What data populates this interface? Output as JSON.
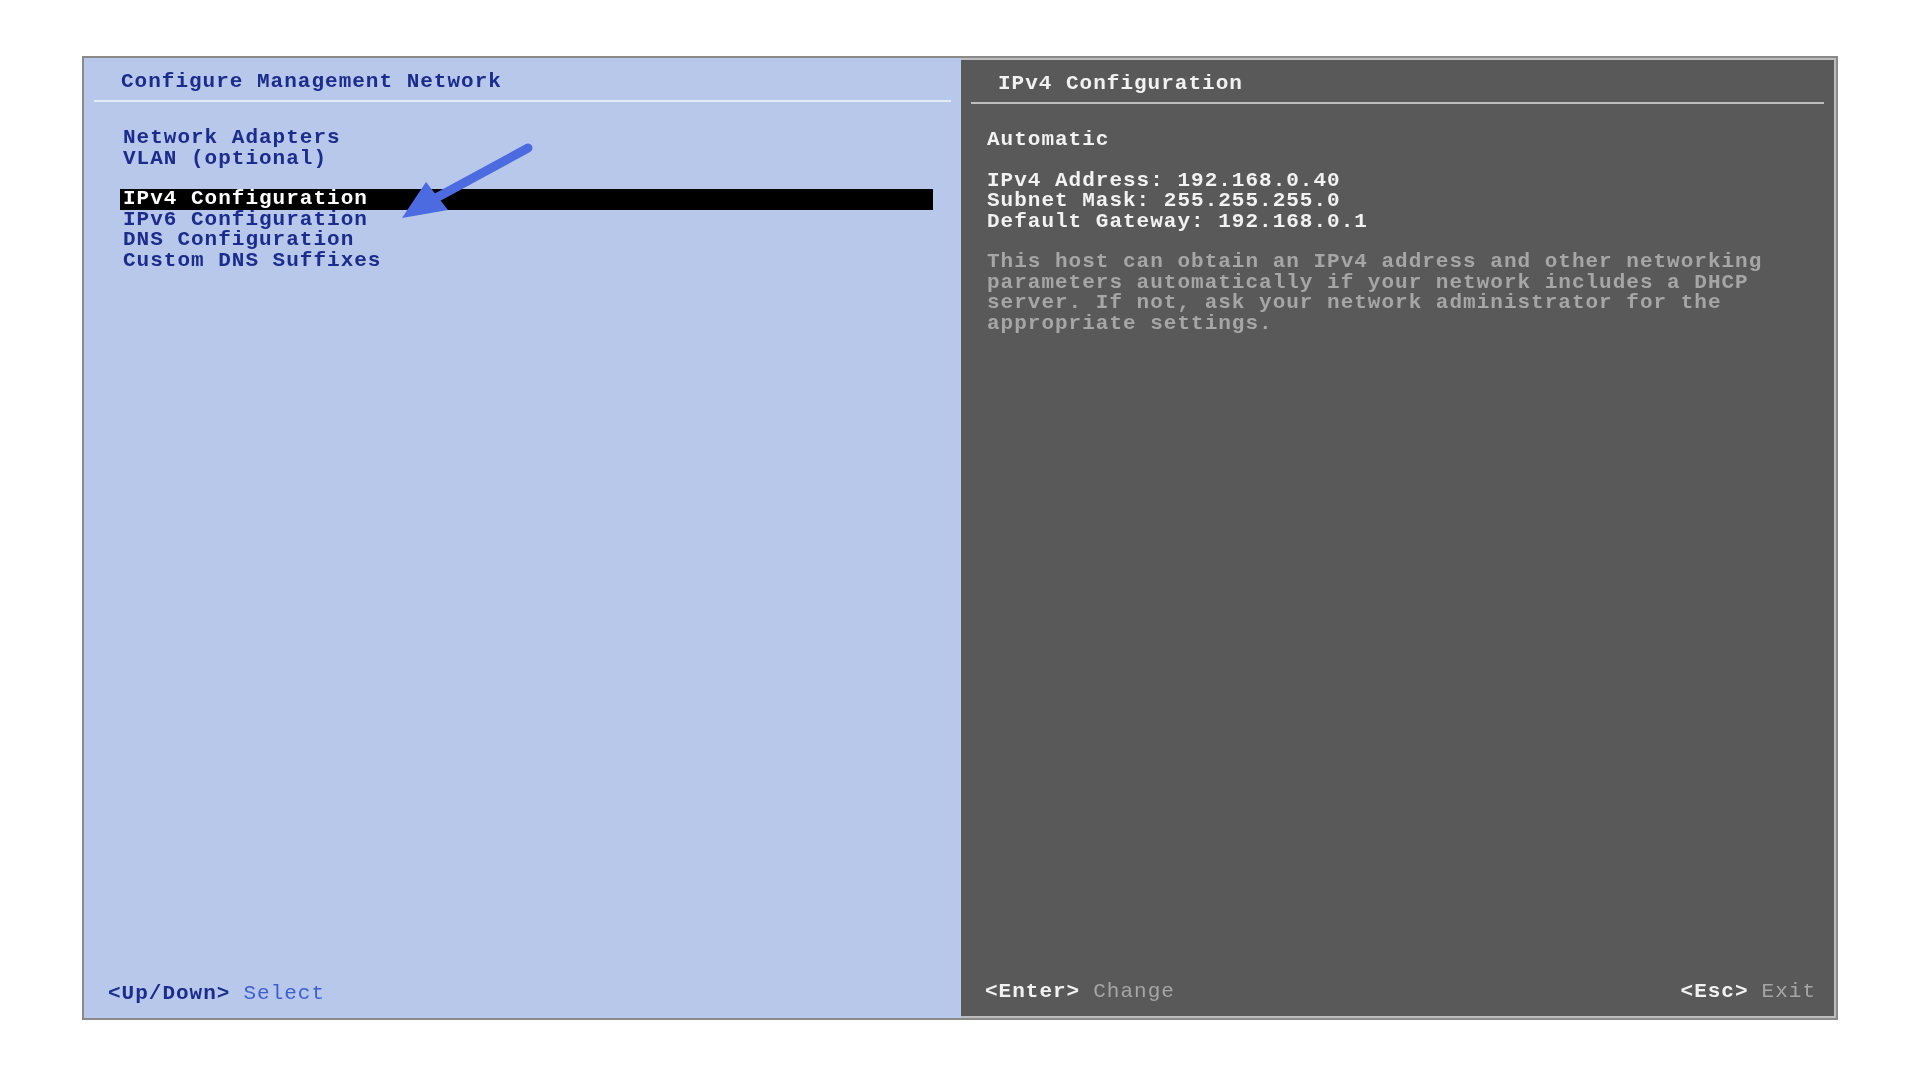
{
  "left_panel": {
    "title": "Configure Management Network",
    "menu_groups": [
      [
        {
          "label": "Network Adapters",
          "selected": false
        },
        {
          "label": "VLAN (optional)",
          "selected": false
        }
      ],
      [
        {
          "label": "IPv4 Configuration",
          "selected": true
        },
        {
          "label": "IPv6 Configuration",
          "selected": false
        },
        {
          "label": "DNS Configuration",
          "selected": false
        },
        {
          "label": "Custom DNS Suffixes",
          "selected": false
        }
      ]
    ],
    "footer_hints": [
      {
        "key": "<Up/Down>",
        "action": "Select"
      }
    ]
  },
  "right_panel": {
    "title": "IPv4 Configuration",
    "mode": "Automatic",
    "settings": [
      "IPv4 Address: 192.168.0.40",
      "Subnet Mask: 255.255.255.0",
      "Default Gateway: 192.168.0.1"
    ],
    "description": "This host can obtain an IPv4 address and other networking parameters automatically if your network includes a DHCP server. If not, ask your network administrator for the appropriate settings.",
    "footer_hints": [
      {
        "key": "<Enter>",
        "action": "Change"
      },
      {
        "key": "<Esc>",
        "action": "Exit"
      }
    ]
  }
}
